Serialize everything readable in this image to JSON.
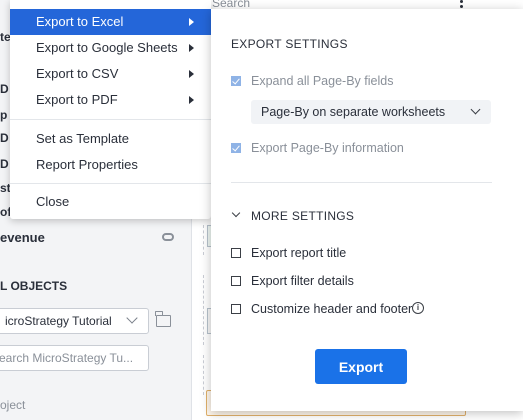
{
  "background": {
    "top_search_placeholder": "Search",
    "clipped_rows": [
      "te",
      "D",
      "p",
      "D",
      "D",
      "st",
      "of"
    ],
    "revenue_label": "evenue",
    "section_title": "L OBJECTS",
    "project_select_value": "icroStrategy Tutorial",
    "search_placeholder": "earch MicroStrategy Tu...",
    "object_label": "oject"
  },
  "menu": {
    "items": [
      {
        "label": "Export to Excel",
        "submenu": true,
        "active": true
      },
      {
        "label": "Export to Google Sheets",
        "submenu": true,
        "active": false
      },
      {
        "label": "Export to CSV",
        "submenu": true,
        "active": false
      },
      {
        "label": "Export to PDF",
        "submenu": true,
        "active": false
      },
      {
        "label": "Set as Template",
        "submenu": false,
        "active": false
      },
      {
        "label": "Report Properties",
        "submenu": false,
        "active": false
      },
      {
        "label": "Close",
        "submenu": false,
        "active": false
      }
    ]
  },
  "export_panel": {
    "title": "EXPORT SETTINGS",
    "expand_pageby": {
      "label": "Expand all Page-By fields",
      "checked": true,
      "disabled": true
    },
    "pageby_mode": {
      "value": "Page-By on separate worksheets"
    },
    "export_pageby_info": {
      "label": "Export Page-By information",
      "checked": true,
      "disabled": true
    },
    "more_settings_label": "MORE SETTINGS",
    "export_report_title": {
      "label": "Export report title",
      "checked": false
    },
    "export_filter_details": {
      "label": "Export filter details",
      "checked": false
    },
    "customize_header_footer": {
      "label": "Customize header and footer",
      "checked": false
    },
    "export_button_label": "Export"
  },
  "colors": {
    "accent": "#2466d9",
    "button": "#1a72e8",
    "checkbox_disabled_checked": "#8fb3e6"
  },
  "icons": [
    "submenu-caret-icon",
    "chevron-down-icon",
    "checkbox-icon",
    "info-icon",
    "folder-icon",
    "kebab-icon",
    "link-icon"
  ]
}
